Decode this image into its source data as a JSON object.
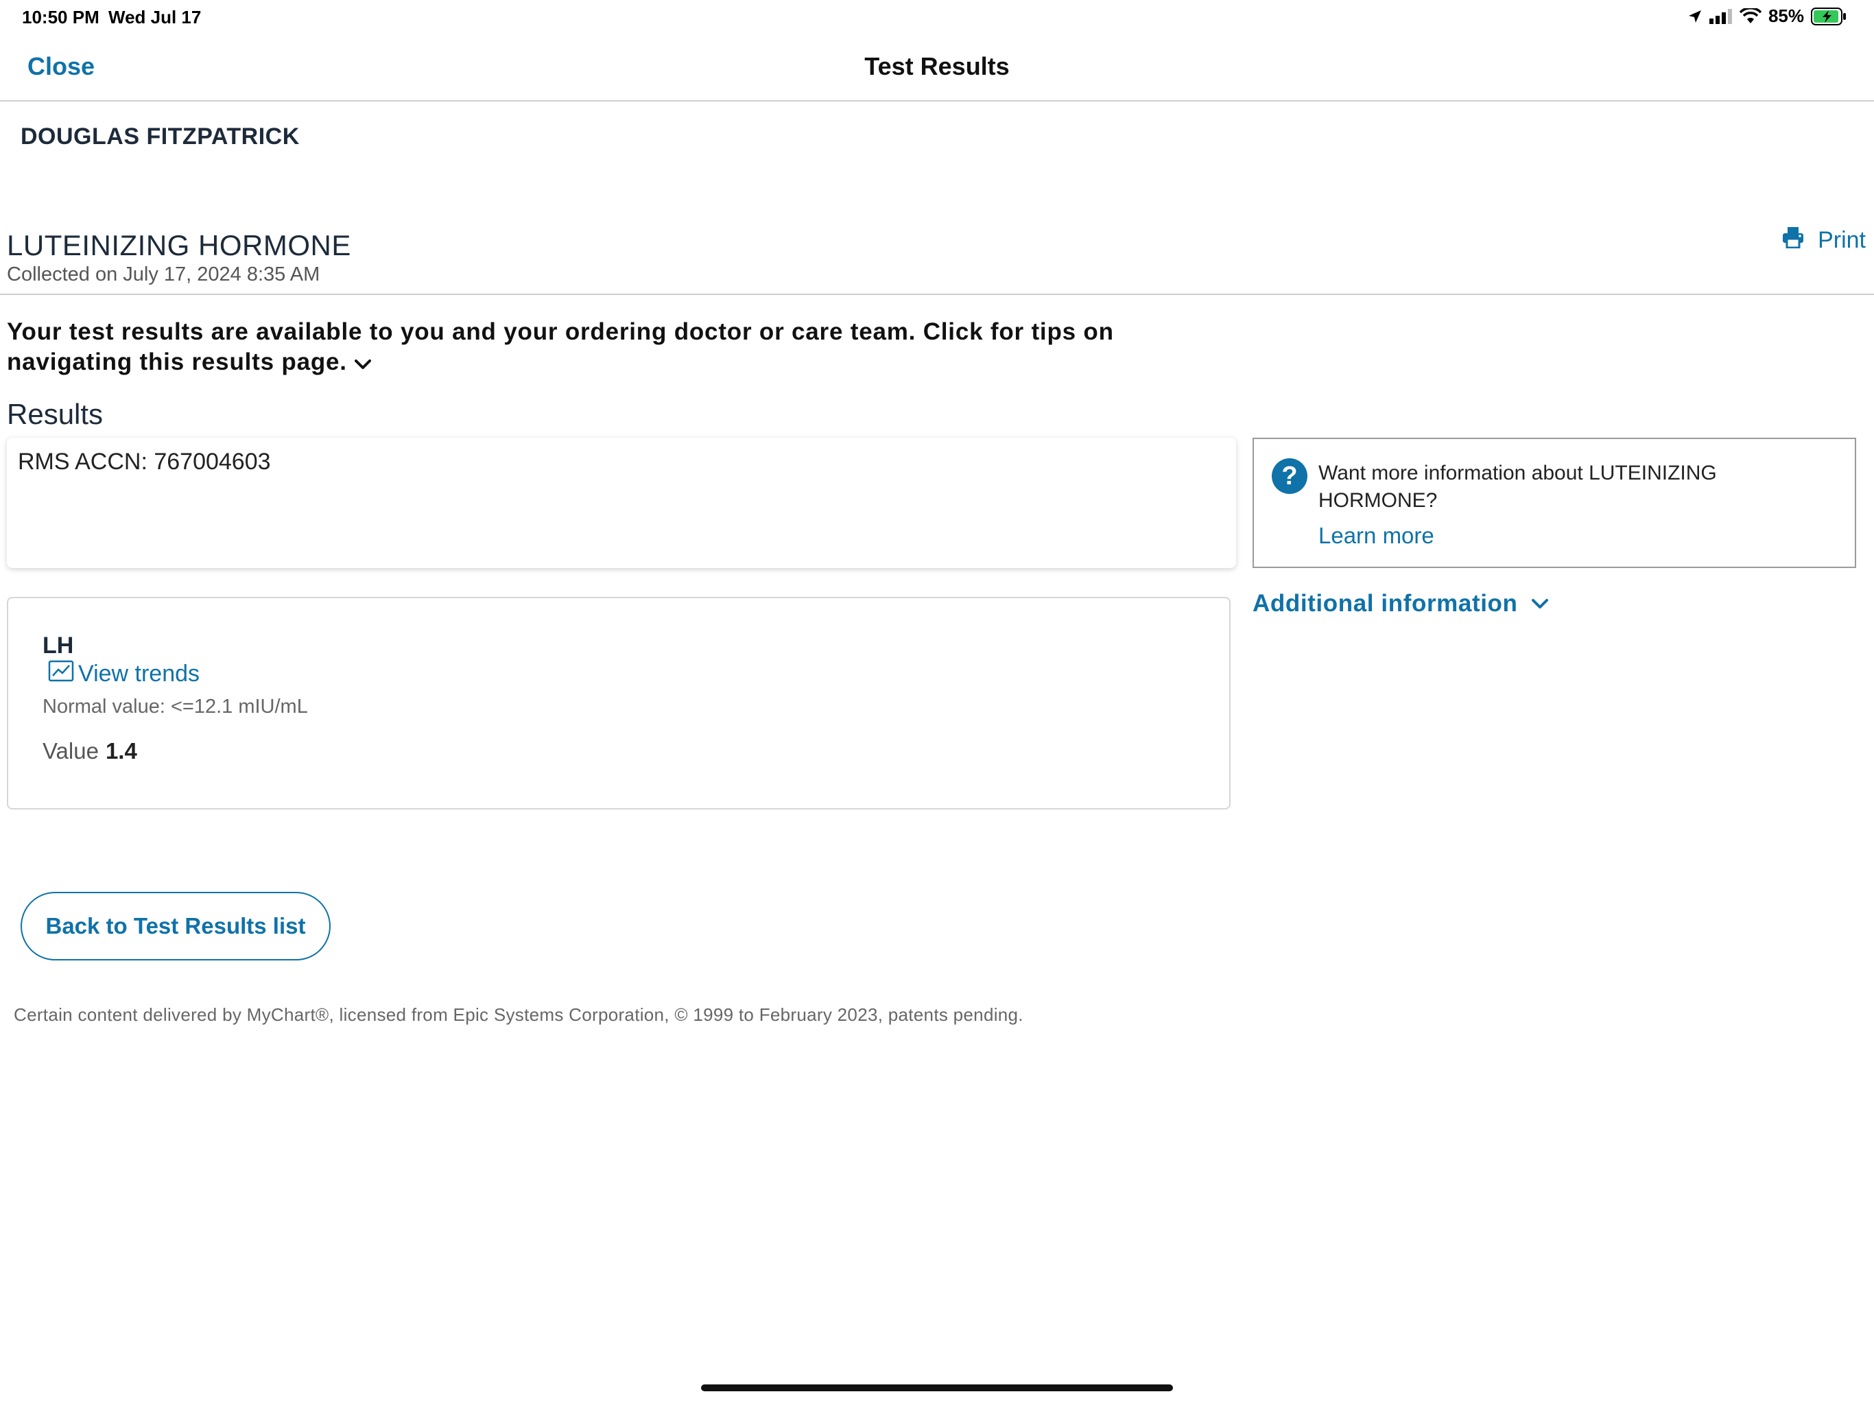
{
  "status_bar": {
    "time": "10:50 PM",
    "date": "Wed Jul 17",
    "battery": "85%",
    "icons": [
      "location-icon",
      "signal-icon",
      "wifi-icon",
      "battery-icon"
    ]
  },
  "navbar": {
    "close_label": "Close",
    "title": "Test Results"
  },
  "patient": {
    "name": "DOUGLAS FITZPATRICK"
  },
  "test": {
    "title": "LUTEINIZING HORMONE",
    "collected": "Collected on July 17, 2024 8:35 AM",
    "print_label": "Print"
  },
  "info": {
    "text": "Your test results are available to you and your ordering doctor or care team. Click for tips on navigating this results page."
  },
  "results": {
    "heading": "Results",
    "accession": "RMS ACCN: 767004603",
    "component": {
      "name": "LH",
      "trends_label": "View trends",
      "normal_value": "Normal value: <=12.1 mIU/mL",
      "value_label": "Value",
      "value": "1.4"
    }
  },
  "learn": {
    "question": "Want more information about LUTEINIZING HORMONE?",
    "link_label": "Learn more"
  },
  "additional_info_label": "Additional information",
  "back_button_label": "Back to Test Results list",
  "footer": "Certain content delivered by MyChart®, licensed from Epic Systems Corporation, © 1999 to February 2023, patents pending.",
  "colors": {
    "accent": "#0f72a8",
    "text_dark": "#1d2a3a",
    "divider": "#cfcfcf",
    "battery_fill": "#34c759"
  }
}
